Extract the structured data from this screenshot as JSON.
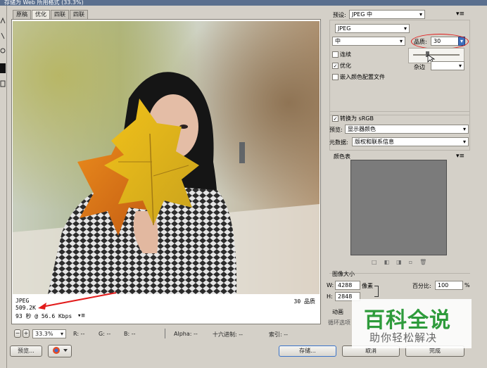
{
  "window": {
    "title": "存储为 Web 所用格式 (33.3%)"
  },
  "tabs": [
    "原稿",
    "优化",
    "四联",
    "四联"
  ],
  "preview_info": {
    "format": "JPEG",
    "file_size": "509.2K",
    "download_time": "93 秒 @ 56.6 Kbps",
    "quality_label": "30 品质"
  },
  "status": {
    "zoom": "33.3%",
    "r": "R: --",
    "g": "G: --",
    "b": "B: --",
    "alpha": "Alpha: --",
    "hex": "十六进制: --",
    "index": "索引: --"
  },
  "bottom_buttons": {
    "preview": "预览...",
    "save": "存储...",
    "cancel": "取消",
    "done": "完成"
  },
  "settings": {
    "preset_label": "预设:",
    "preset_value": "JPEG 中",
    "format_value": "JPEG",
    "compression_value": "中",
    "quality_label": "品质:",
    "quality_value": "30",
    "progressive_label": "连续",
    "progressive_checked": false,
    "optimized_label": "优化",
    "optimized_checked": true,
    "blur_label": "杂边",
    "embed_profile_label": "嵌入颜色配置文件",
    "embed_profile_checked": false
  },
  "color": {
    "convert_label": "转换为 sRGB",
    "convert_checked": true,
    "preview_label": "预览:",
    "preview_value": "显示器颜色",
    "metadata_label": "元数据:",
    "metadata_value": "版权和联系信息",
    "color_table_label": "颜色表"
  },
  "image_size": {
    "title": "图像大小",
    "w_label": "W:",
    "w_value": "4288",
    "h_label": "H:",
    "h_value": "2848",
    "unit": "像素",
    "percent_label": "百分比:",
    "percent_value": "100",
    "percent_unit": "%"
  },
  "animation": {
    "title": "动画",
    "loop_label": "循环选项"
  },
  "watermark": {
    "title": "百科全说",
    "subtitle": "助你轻松解决"
  },
  "colors": {
    "accent_red": "#e21b1b",
    "watermark_green": "#2e9b3b"
  }
}
